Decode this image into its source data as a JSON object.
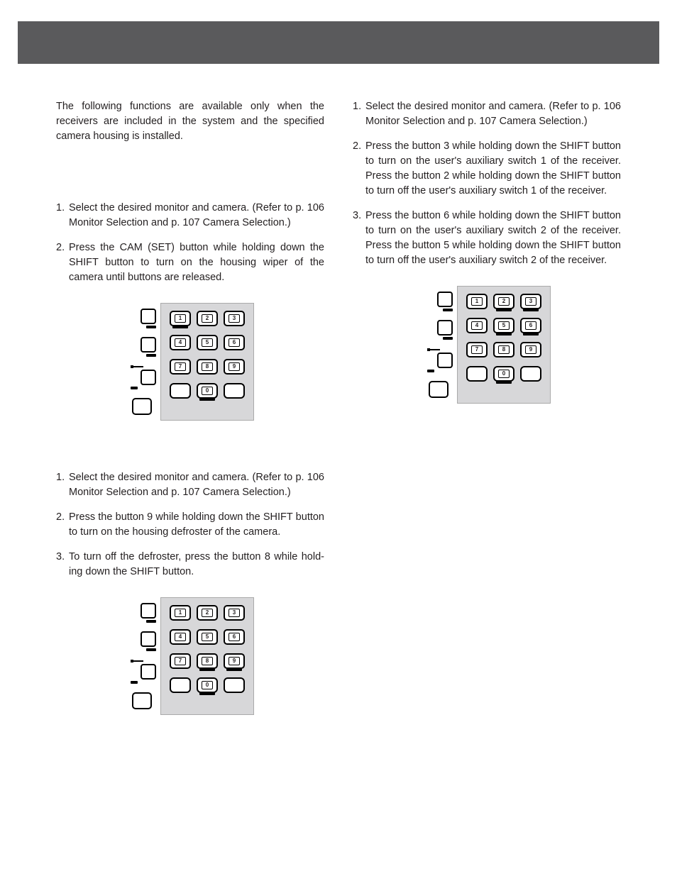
{
  "intro": "The following functions are available only when the receivers are included in the system and the specified camera housing is installed.",
  "left": {
    "wiper": {
      "items": [
        "Select the desired monitor and camera. (Refer to p. 106 Monitor Selection and p. 107 Camera Selection.)",
        "Press the CAM (SET) button while holding down the SHIFT button to turn on the housing wiper of the camera until buttons are released."
      ],
      "keypad_highlight": [
        1
      ]
    },
    "defroster": {
      "items": [
        "Select the desired monitor and camera. (Refer to p. 106 Monitor Selection and p. 107 Camera Selection.)",
        "Press the button 9 while holding down the SHIFT button to turn on the housing defroster of the camera.",
        "To turn off the defroster, press the button 8 while hold­ing down the SHIFT button."
      ],
      "keypad_highlight": [
        8,
        9
      ]
    }
  },
  "right": {
    "aux": {
      "items": [
        "Select the desired monitor and camera. (Refer to p. 106 Monitor Selection and p. 107 Camera Selection.)",
        "Press the button 3 while holding down the SHIFT button to turn on the user's auxiliary switch 1 of the receiver. Press  the button 2 while holding down the SHIFT but­ton to turn off the user's auxiliary switch 1 of the receiv­er.",
        "Press the button 6 while holding down the SHIFT button to turn on the user's auxiliary switch 2 of the receiver. Press the button 5 while holding down the SHIFT button to turn off the user's auxiliary switch 2 of the receiver."
      ],
      "keypad_highlight": [
        2,
        3,
        5,
        6
      ]
    }
  },
  "numbers": [
    "1",
    "2",
    "3",
    "4",
    "5",
    "6",
    "7",
    "8",
    "9",
    "0"
  ]
}
